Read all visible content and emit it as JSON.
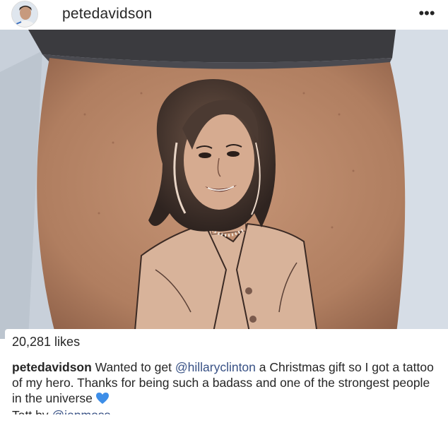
{
  "post": {
    "username": "petedavidson",
    "more_icon": "more-horizontal-icon",
    "photo": {
      "subject": "tattoo-portrait",
      "skin_color": "#b98a6c",
      "sheet_color": "#c8d0da",
      "sock_color": "#3b3b3f"
    },
    "likes": "20,281 likes",
    "caption": {
      "author": "petedavidson",
      "text_1": " Wanted to get ",
      "mention_1": "@hillaryclinton",
      "text_2": " a Christmas gift so I got a tattoo of my hero. Thanks for being such a badass and one of the strongest people in the universe",
      "heart_icon": "blue-heart-icon",
      "heart_color": "#3d8ee8"
    },
    "credit": {
      "label": "Tatt by ",
      "mention": "@ianmoss"
    }
  }
}
